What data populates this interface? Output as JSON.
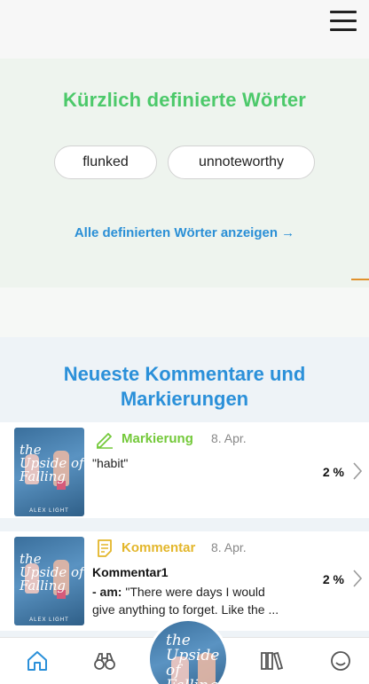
{
  "header": {
    "menu_icon": "hamburger-menu-icon"
  },
  "defined_words": {
    "title": "Kürzlich definierte Wörter",
    "words": [
      "flunked",
      "unnoteworthy"
    ],
    "show_all_link": "Alle definierten Wörter anzeigen →"
  },
  "recent": {
    "title": "Neueste Kommentare und Markierungen",
    "items": [
      {
        "type_label": "Markierung",
        "type_icon": "pencil-icon",
        "date": "8. Apr.",
        "quote": "\"habit\"",
        "progress": "2 %",
        "cover_title": "the Upside of Falling",
        "cover_author": "ALEX LIGHT"
      },
      {
        "type_label": "Kommentar",
        "type_icon": "note-icon",
        "date": "8. Apr.",
        "comment_title": "Kommentar1",
        "comment_author": "- am:",
        "comment_text": " \"There were days I would",
        "comment_text2": "give anything to forget. Like the  ...",
        "progress": "2 %",
        "cover_title": "the Upside of Falling",
        "cover_author": "ALEX LIGHT"
      }
    ]
  },
  "nav": {
    "items": [
      "home-icon",
      "discover-binoculars-icon",
      "current-book-cover",
      "library-icon",
      "profile-icon"
    ],
    "center_cover_title": "the Upside of Falling"
  },
  "colors": {
    "green_title": "#4cc96a",
    "blue_accent": "#2b90d9",
    "highlight_green": "#74c93a",
    "comment_yellow": "#e3b62a"
  }
}
